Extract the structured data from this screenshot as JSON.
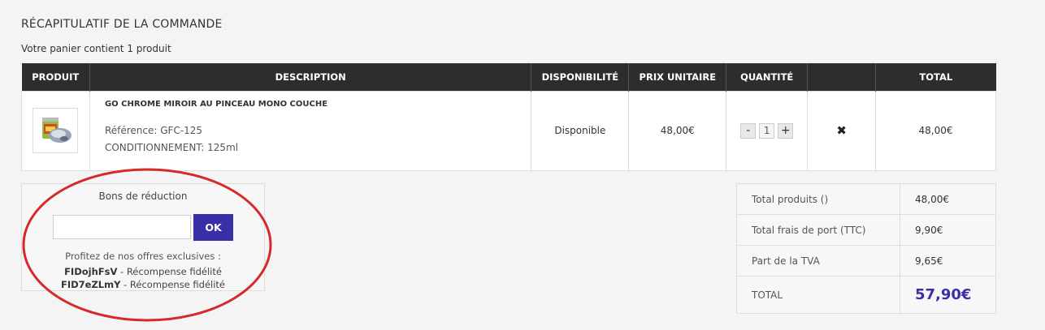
{
  "page": {
    "title": "RÉCAPITULATIF DE LA COMMANDE",
    "cart_count": "Votre panier contient 1 produit"
  },
  "cart_table": {
    "headers": [
      "PRODUIT",
      "DESCRIPTION",
      "DISPONIBILITÉ",
      "PRIX UNITAIRE",
      "QUANTITÉ",
      "",
      "TOTAL"
    ],
    "rows": [
      {
        "product_image": "paint-can-and-chrome-part-image",
        "name": "GO CHROME MIROIR AU PINCEAU MONO COUCHE",
        "reference": "Référence: GFC-125",
        "conditionnement": "CONDITIONNEMENT: 125ml",
        "availability": "Disponible",
        "unit_price": "48,00€",
        "qty_minus": "-",
        "quantity": "1",
        "qty_plus": "+",
        "remove": "✖",
        "total": "48,00€"
      }
    ]
  },
  "voucher": {
    "title": "Bons de réduction",
    "input_value": "",
    "ok_label": "OK",
    "offers_title": "Profitez de nos offres exclusives :",
    "offers": [
      {
        "code": "FIDojhFsV",
        "desc": " - Récompense fidélité"
      },
      {
        "code": "FID7eZLmY",
        "desc": " - Récompense fidélité"
      }
    ]
  },
  "totals": {
    "rows": [
      {
        "label": "Total produits ()",
        "value": "48,00€"
      },
      {
        "label": "Total frais de port (TTC)",
        "value": "9,90€"
      },
      {
        "label": "Part de la TVA",
        "value": "9,65€"
      }
    ],
    "grand_label": "TOTAL",
    "grand_value": "57,90€"
  },
  "colors": {
    "header_bg": "#2d2d2d",
    "accent": "#3b2fa8",
    "annotation_ellipse": "#d42a2a"
  }
}
